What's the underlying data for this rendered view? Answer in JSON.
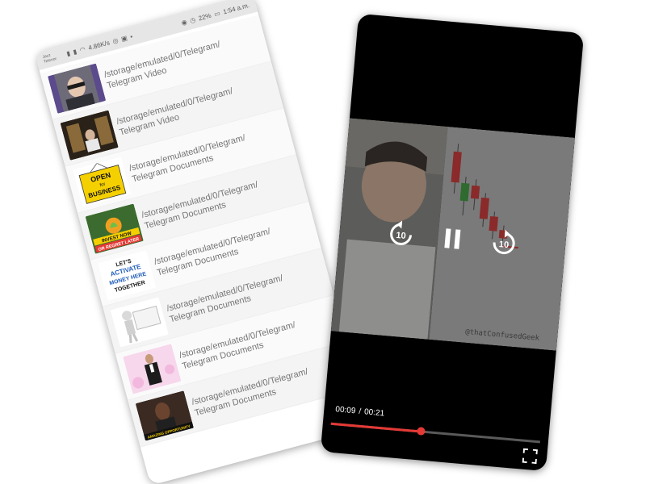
{
  "status_bar": {
    "carrier_line1": "Jazz",
    "carrier_line2": "Telenor",
    "net_speed": "4.86K/s",
    "battery": "22%",
    "time": "1:54 a.m."
  },
  "file_list": [
    {
      "path": "/storage/emulated/0/Telegram/",
      "folder": "Telegram Video",
      "thumb": "man-with-glasses"
    },
    {
      "path": "/storage/emulated/0/Telegram/",
      "folder": "Telegram Video",
      "thumb": "dark-room"
    },
    {
      "path": "/storage/emulated/0/Telegram/",
      "folder": "Telegram Documents",
      "thumb": "open-sign",
      "thumb_text": [
        "OPEN",
        "for",
        "BUSINESS"
      ]
    },
    {
      "path": "/storage/emulated/0/Telegram/",
      "folder": "Telegram Documents",
      "thumb": "invest-now",
      "thumb_text": [
        "INVEST NOW",
        "OR REGRET LATER"
      ]
    },
    {
      "path": "/storage/emulated/0/Telegram/",
      "folder": "Telegram Documents",
      "thumb": "activate-money",
      "thumb_text": [
        "LET'S",
        "ACTIVATE",
        "MONEY HERE",
        "TOGETHER"
      ]
    },
    {
      "path": "/storage/emulated/0/Telegram/",
      "folder": "Telegram Documents",
      "thumb": "figure-with-board"
    },
    {
      "path": "/storage/emulated/0/Telegram/",
      "folder": "Telegram Documents",
      "thumb": "man-in-suit"
    },
    {
      "path": "/storage/emulated/0/Telegram/",
      "folder": "Telegram Documents",
      "thumb": "amazing-opportunity",
      "thumb_text": [
        "AMAZING OPPORTUNITY"
      ]
    }
  ],
  "video_player": {
    "watermark": "@thatConfusedGeek",
    "current_time": "00:09",
    "separator": "/",
    "duration": "00:21",
    "progress_fraction": 0.43,
    "rewind_label": "10",
    "forward_label": "10",
    "accent_color": "#e53935",
    "icons": {
      "rewind": "replay-10-icon",
      "pause": "pause-icon",
      "forward": "forward-10-icon",
      "fullscreen": "fullscreen-icon"
    }
  }
}
